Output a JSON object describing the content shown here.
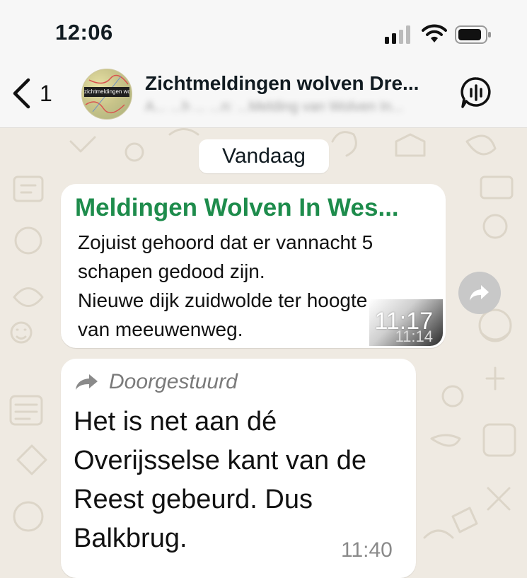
{
  "status_bar": {
    "time": "12:06"
  },
  "header": {
    "back_count": "1",
    "avatar_label": "zichtmeldingen wolf",
    "title": "Zichtmeldingen wolven Dre...",
    "subtitle": "A... ...h ... ...n: ...Melding van Wolven In..."
  },
  "chat": {
    "date_label": "Vandaag",
    "messages": [
      {
        "sender": "Meldingen Wolven In Wes...",
        "lines": [
          "Zojuist gehoord dat er vannacht 5",
          "schapen gedood zijn.",
          "Nieuwe dijk zuidwolde ter hoogte",
          "van meeuwenweg."
        ],
        "time": "11:17",
        "time_original": "11:14"
      },
      {
        "forwarded_label": "Doorgestuurd",
        "lines": [
          "Het is net aan dé",
          "Overijsselse kant van de",
          "Reest gebeurd. Dus",
          "Balkbrug."
        ],
        "time": "11:40"
      }
    ]
  },
  "colors": {
    "sender_green": "#1e8c4c",
    "background": "#efeae2"
  },
  "icons": [
    "back-chevron-icon",
    "signal-icon",
    "wifi-icon",
    "battery-icon",
    "voice-chat-icon",
    "forward-icon"
  ]
}
